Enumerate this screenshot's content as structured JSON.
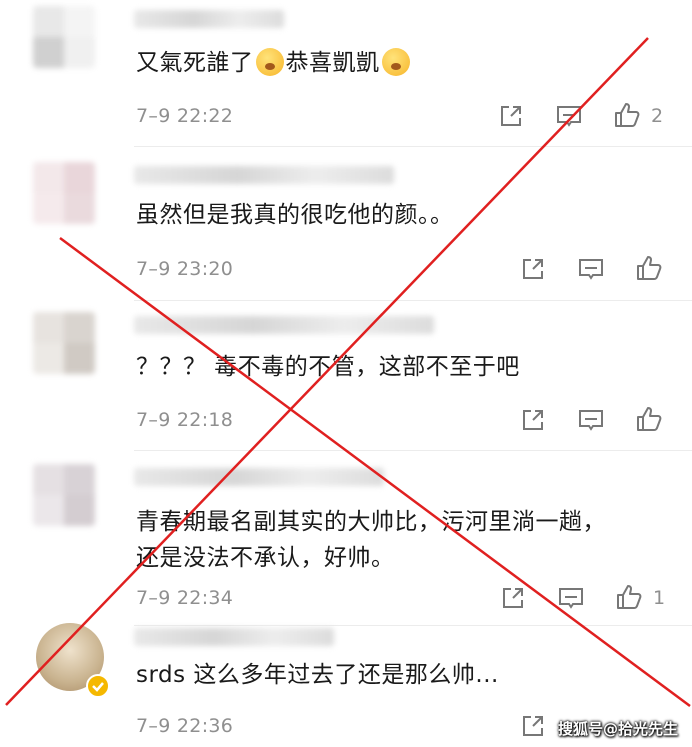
{
  "comments": [
    {
      "text_before_emoji_1": "又氣死誰了",
      "text_between": "恭喜凱凱",
      "emoji_1": "fearful-face-emoji",
      "emoji_2": "thinking-face-emoji",
      "time": "7–9 22:22",
      "likes": "2",
      "avatar_colors": [
        "#e8e8e8",
        "#f4f4f4",
        "#d0d0d0",
        "#f0f0f0"
      ]
    },
    {
      "text": "虽然但是我真的很吃他的颜。。",
      "time": "7–9 23:20",
      "likes": "",
      "avatar_colors": [
        "#f3e8ea",
        "#e9d6da",
        "#f5eaec",
        "#eadadd"
      ]
    },
    {
      "text": "？？？ 毒不毒的不管，这部不至于吧",
      "time": "7–9 22:18",
      "likes": "",
      "avatar_colors": [
        "#e7e3df",
        "#d9d4cf",
        "#ece9e5",
        "#d0cac4"
      ]
    },
    {
      "text_line1": "青春期最名副其实的大帅比，污河里淌一趟，",
      "text_line2": "还是没法不承认，好帅。",
      "time": "7–9 22:34",
      "likes": "1",
      "avatar_colors": [
        "#e5e0e3",
        "#d8d2d6",
        "#ebe7ea",
        "#d4cdd1"
      ]
    },
    {
      "text": "srds 这么多年过去了还是那么帅...",
      "time": "7–9 22:36",
      "likes": "",
      "avatar_colors": [
        "#d8c6a8",
        "#c9b38f",
        "#efe2cc",
        "#b99d77"
      ]
    }
  ],
  "icons": {
    "share": "share-icon",
    "reply": "reply-icon",
    "like": "thumbs-up-icon",
    "verified": "verified-badge-icon"
  },
  "watermark": "搜狐号@拾光先生",
  "colors": {
    "cross": "#e02020",
    "meta": "#8f8f8f",
    "verified": "#f5b800"
  }
}
